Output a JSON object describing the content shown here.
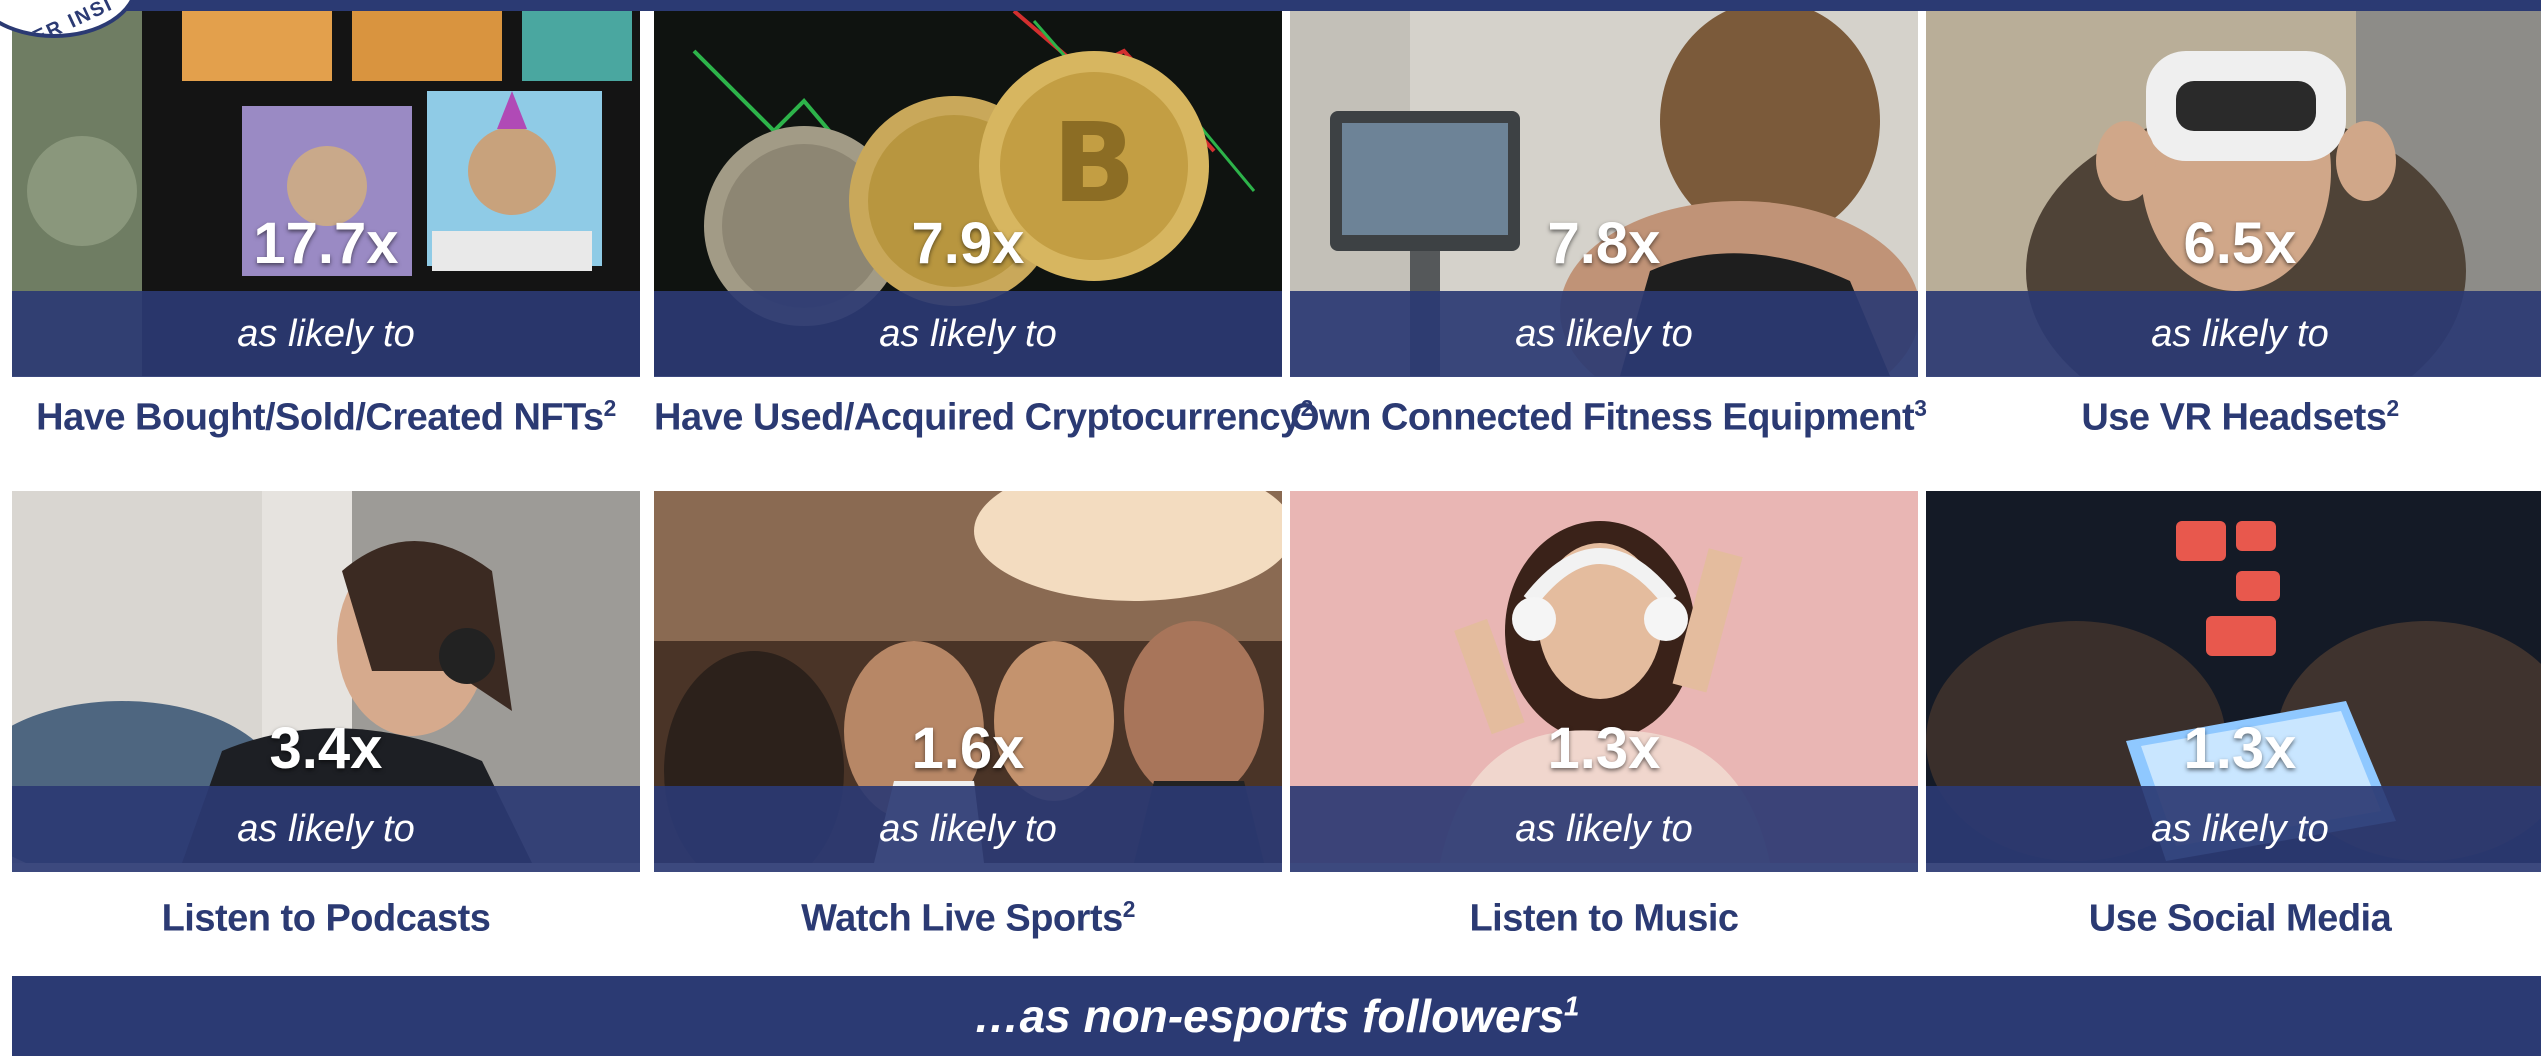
{
  "logo": {
    "text": "ER INSI"
  },
  "row1": [
    {
      "multiplier": "17.7x",
      "likely_text": "as likely to",
      "activity": "Have Bought/Sold/Created NFTs",
      "footnote": "2",
      "image": "nft-ape-art"
    },
    {
      "multiplier": "7.9x",
      "likely_text": "as likely to",
      "activity": "Have Used/Acquired Cryptocurrency",
      "footnote": "2",
      "image": "crypto-coins"
    },
    {
      "multiplier": "7.8x",
      "likely_text": "as likely to",
      "activity": "Own Connected Fitness Equipment",
      "footnote": "3",
      "image": "fitness-bike"
    },
    {
      "multiplier": "6.5x",
      "likely_text": "as likely to",
      "activity": "Use VR Headsets",
      "footnote": "2",
      "image": "vr-headset"
    }
  ],
  "row2": [
    {
      "multiplier": "3.4x",
      "likely_text": "as likely to",
      "activity": "Listen to Podcasts",
      "footnote": "",
      "image": "podcast-listener"
    },
    {
      "multiplier": "1.6x",
      "likely_text": "as likely to",
      "activity": "Watch Live Sports",
      "footnote": "2",
      "image": "sports-crowd"
    },
    {
      "multiplier": "1.3x",
      "likely_text": "as likely to",
      "activity": "Listen to Music",
      "footnote": "",
      "image": "music-listener"
    },
    {
      "multiplier": "1.3x",
      "likely_text": "as likely to",
      "activity": "Use Social Media",
      "footnote": "",
      "image": "social-phone"
    }
  ],
  "footer": {
    "text": "…as non-esports followers",
    "footnote": "1"
  },
  "colors": {
    "navy": "#2b3a73",
    "white": "#ffffff"
  }
}
